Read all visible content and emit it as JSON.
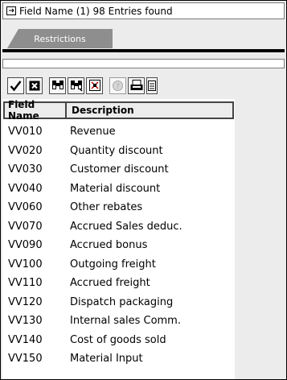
{
  "window": {
    "title": "Field Name (1)   98 Entries found"
  },
  "tabs": [
    {
      "label": "Restrictions"
    }
  ],
  "toolbar": {
    "buttons": [
      {
        "icon": "checkmark-icon"
      },
      {
        "icon": "close-icon"
      },
      {
        "icon": "find-icon"
      },
      {
        "icon": "find-next-icon"
      },
      {
        "icon": "sort-icon"
      },
      {
        "icon": "help-icon"
      },
      {
        "icon": "print-icon"
      },
      {
        "icon": "document-icon"
      }
    ]
  },
  "table": {
    "headers": {
      "code": "Field Name",
      "description": "Description"
    },
    "rows": [
      {
        "code": "VV010",
        "description": "Revenue"
      },
      {
        "code": "VV020",
        "description": "Quantity discount"
      },
      {
        "code": "VV030",
        "description": "Customer discount"
      },
      {
        "code": "VV040",
        "description": "Material discount"
      },
      {
        "code": "VV060",
        "description": "Other rebates"
      },
      {
        "code": "VV070",
        "description": "Accrued Sales deduc."
      },
      {
        "code": "VV090",
        "description": "Accrued bonus"
      },
      {
        "code": "VV100",
        "description": "Outgoing freight"
      },
      {
        "code": "VV110",
        "description": "Accrued freight"
      },
      {
        "code": "VV120",
        "description": "Dispatch packaging"
      },
      {
        "code": "VV130",
        "description": "Internal sales Comm."
      },
      {
        "code": "VV140",
        "description": "Cost of goods sold"
      },
      {
        "code": "VV150",
        "description": "Material Input"
      }
    ]
  }
}
